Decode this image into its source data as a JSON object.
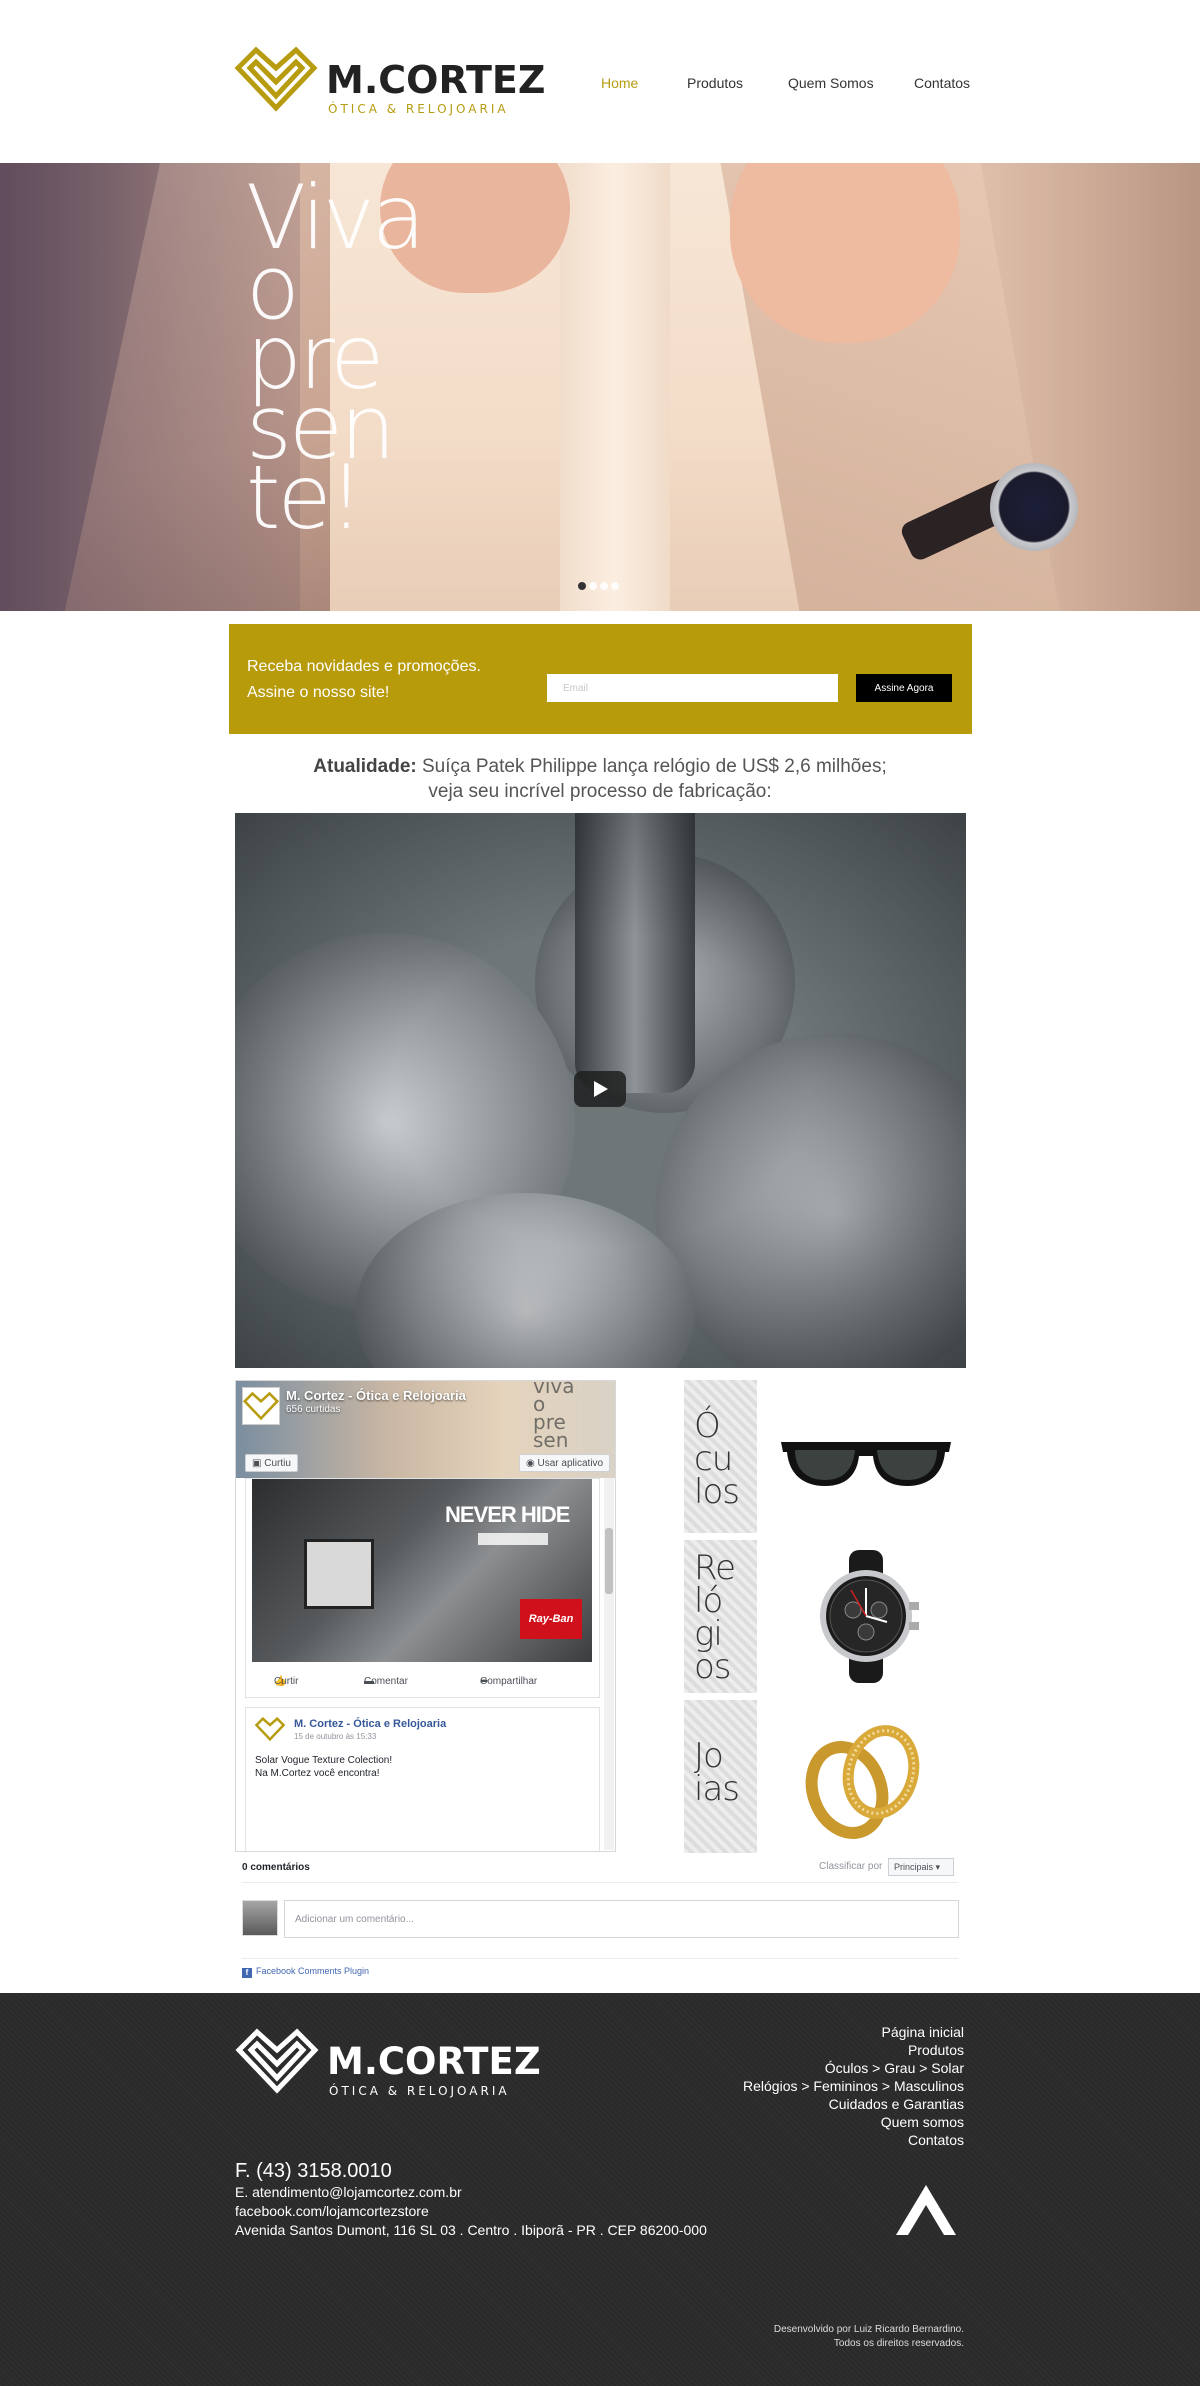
{
  "brand": {
    "name": "M.CORTEZ",
    "tagline": "ÓTICA & RELOJOARIA",
    "accent_color": "#b79c10"
  },
  "nav": {
    "items": [
      {
        "label": "Home",
        "active": true
      },
      {
        "label": "Produtos",
        "active": false
      },
      {
        "label": "Quem Somos",
        "active": false
      },
      {
        "label": "Contatos",
        "active": false
      }
    ]
  },
  "hero": {
    "lines": [
      "Viva",
      "o",
      "pre",
      "sen",
      "te!"
    ],
    "slides": 4,
    "active_slide": 1
  },
  "newsletter": {
    "line1": "Receba novidades e promoções.",
    "line2": "Assine o nosso site!",
    "email_placeholder": "Email",
    "button_label": "Assine Agora",
    "bg_color": "#b89b0a"
  },
  "article": {
    "label": "Atualidade:",
    "title": " Suíça Patek Philippe lança relógio de US$ 2,6 milhões; veja seu incrível processo de fabricação:"
  },
  "video": {
    "play_icon": "play-icon"
  },
  "facebook": {
    "page_name": "M. Cortez - Ótica e Relojoaria",
    "likes": "656 curtidas",
    "cover_text": [
      "viva",
      "o",
      "pre",
      "sen"
    ],
    "like_button": "Curtiu",
    "app_button": "Usar aplicativo",
    "post_banner": "NEVER HIDE",
    "post_brand": "Ray-Ban",
    "actions": [
      "Curtir",
      "Comentar",
      "Compartilhar"
    ],
    "post2": {
      "author": "M. Cortez - Ótica e Relojoaria",
      "date": "15 de outubro às 15:33",
      "text_line1": "Solar Vogue Texture Colection!",
      "text_line2": "Na M.Cortez você encontra!"
    }
  },
  "categories": [
    {
      "label_lines": [
        "Ó",
        "cu",
        "los"
      ],
      "icon": "sunglasses-icon"
    },
    {
      "label_lines": [
        "Re",
        "ló",
        "gi",
        "os"
      ],
      "icon": "watch-icon"
    },
    {
      "label_lines": [
        "Jo",
        "ias"
      ],
      "icon": "rings-icon"
    }
  ],
  "comments": {
    "count_label": "0 comentários",
    "sort_label": "Classificar por",
    "sort_value": "Principais",
    "input_placeholder": "Adicionar um comentário...",
    "plugin_label": "Facebook Comments Plugin"
  },
  "footer": {
    "links": [
      "Página inicial",
      "Produtos",
      "Óculos > Grau > Solar",
      "Relógios > Femininos > Masculinos",
      "Cuidados e Garantias",
      "Quem somos",
      "Contatos"
    ],
    "phone": "F. (43) 3158.0010",
    "email": "E. atendimento@lojamcortez.com.br",
    "facebook": "facebook.com/lojamcortezstore",
    "address": "Avenida Santos Dumont, 116 SL 03 . Centro . Ibiporã - PR . CEP 86200-000",
    "credit1": "Desenvolvido por Luiz Ricardo Bernardino.",
    "credit2": "Todos os direitos reservados.",
    "bg_color": "#2b2b2b"
  }
}
